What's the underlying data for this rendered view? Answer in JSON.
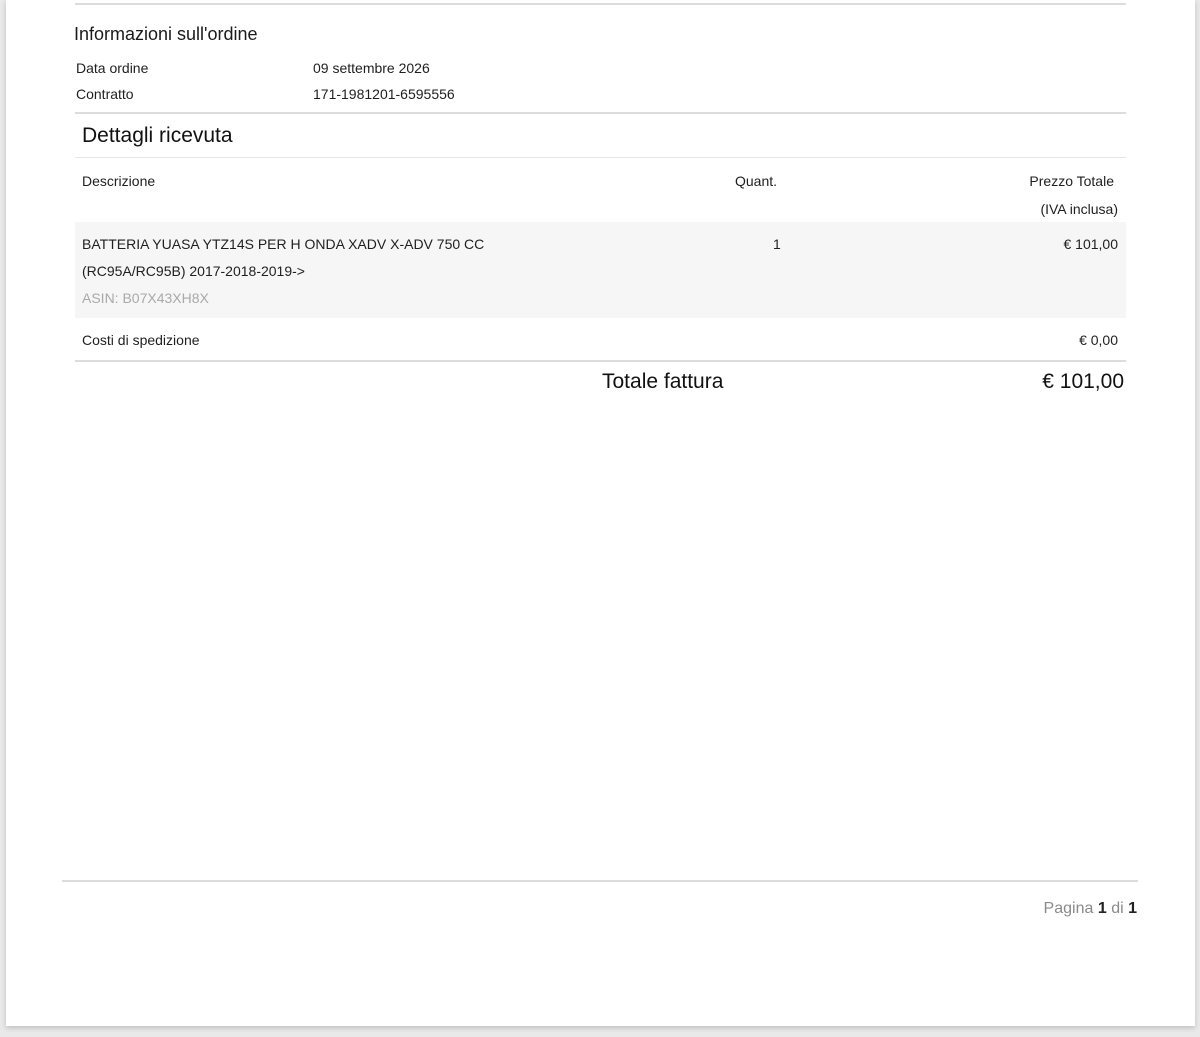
{
  "order_info": {
    "title": "Informazioni sull'ordine",
    "rows": [
      {
        "label": "Data ordine",
        "value": "09 settembre 2026"
      },
      {
        "label": "Contratto",
        "value": "171-1981201-6595556"
      }
    ]
  },
  "receipt": {
    "title": "Dettagli ricevuta",
    "headers": {
      "description": "Descrizione",
      "quantity": "Quant.",
      "total_price": "Prezzo Totale",
      "total_price_note": "(IVA inclusa)"
    },
    "items": [
      {
        "description_line1": "BATTERIA YUASA YTZ14S PER H ONDA XADV X-ADV 750 CC",
        "description_line2": "(RC95A/RC95B) 2017-2018-2019->",
        "asin": "ASIN: B07X43XH8X",
        "quantity": "1",
        "price": "€ 101,00"
      }
    ],
    "shipping": {
      "label": "Costi di spedizione",
      "value": "€ 0,00"
    },
    "total": {
      "label": "Totale fattura",
      "value": "€ 101,00"
    }
  },
  "footer": {
    "pager_prefix": "Pagina",
    "page_current": "1",
    "pager_mid": "di",
    "page_total": "1"
  }
}
